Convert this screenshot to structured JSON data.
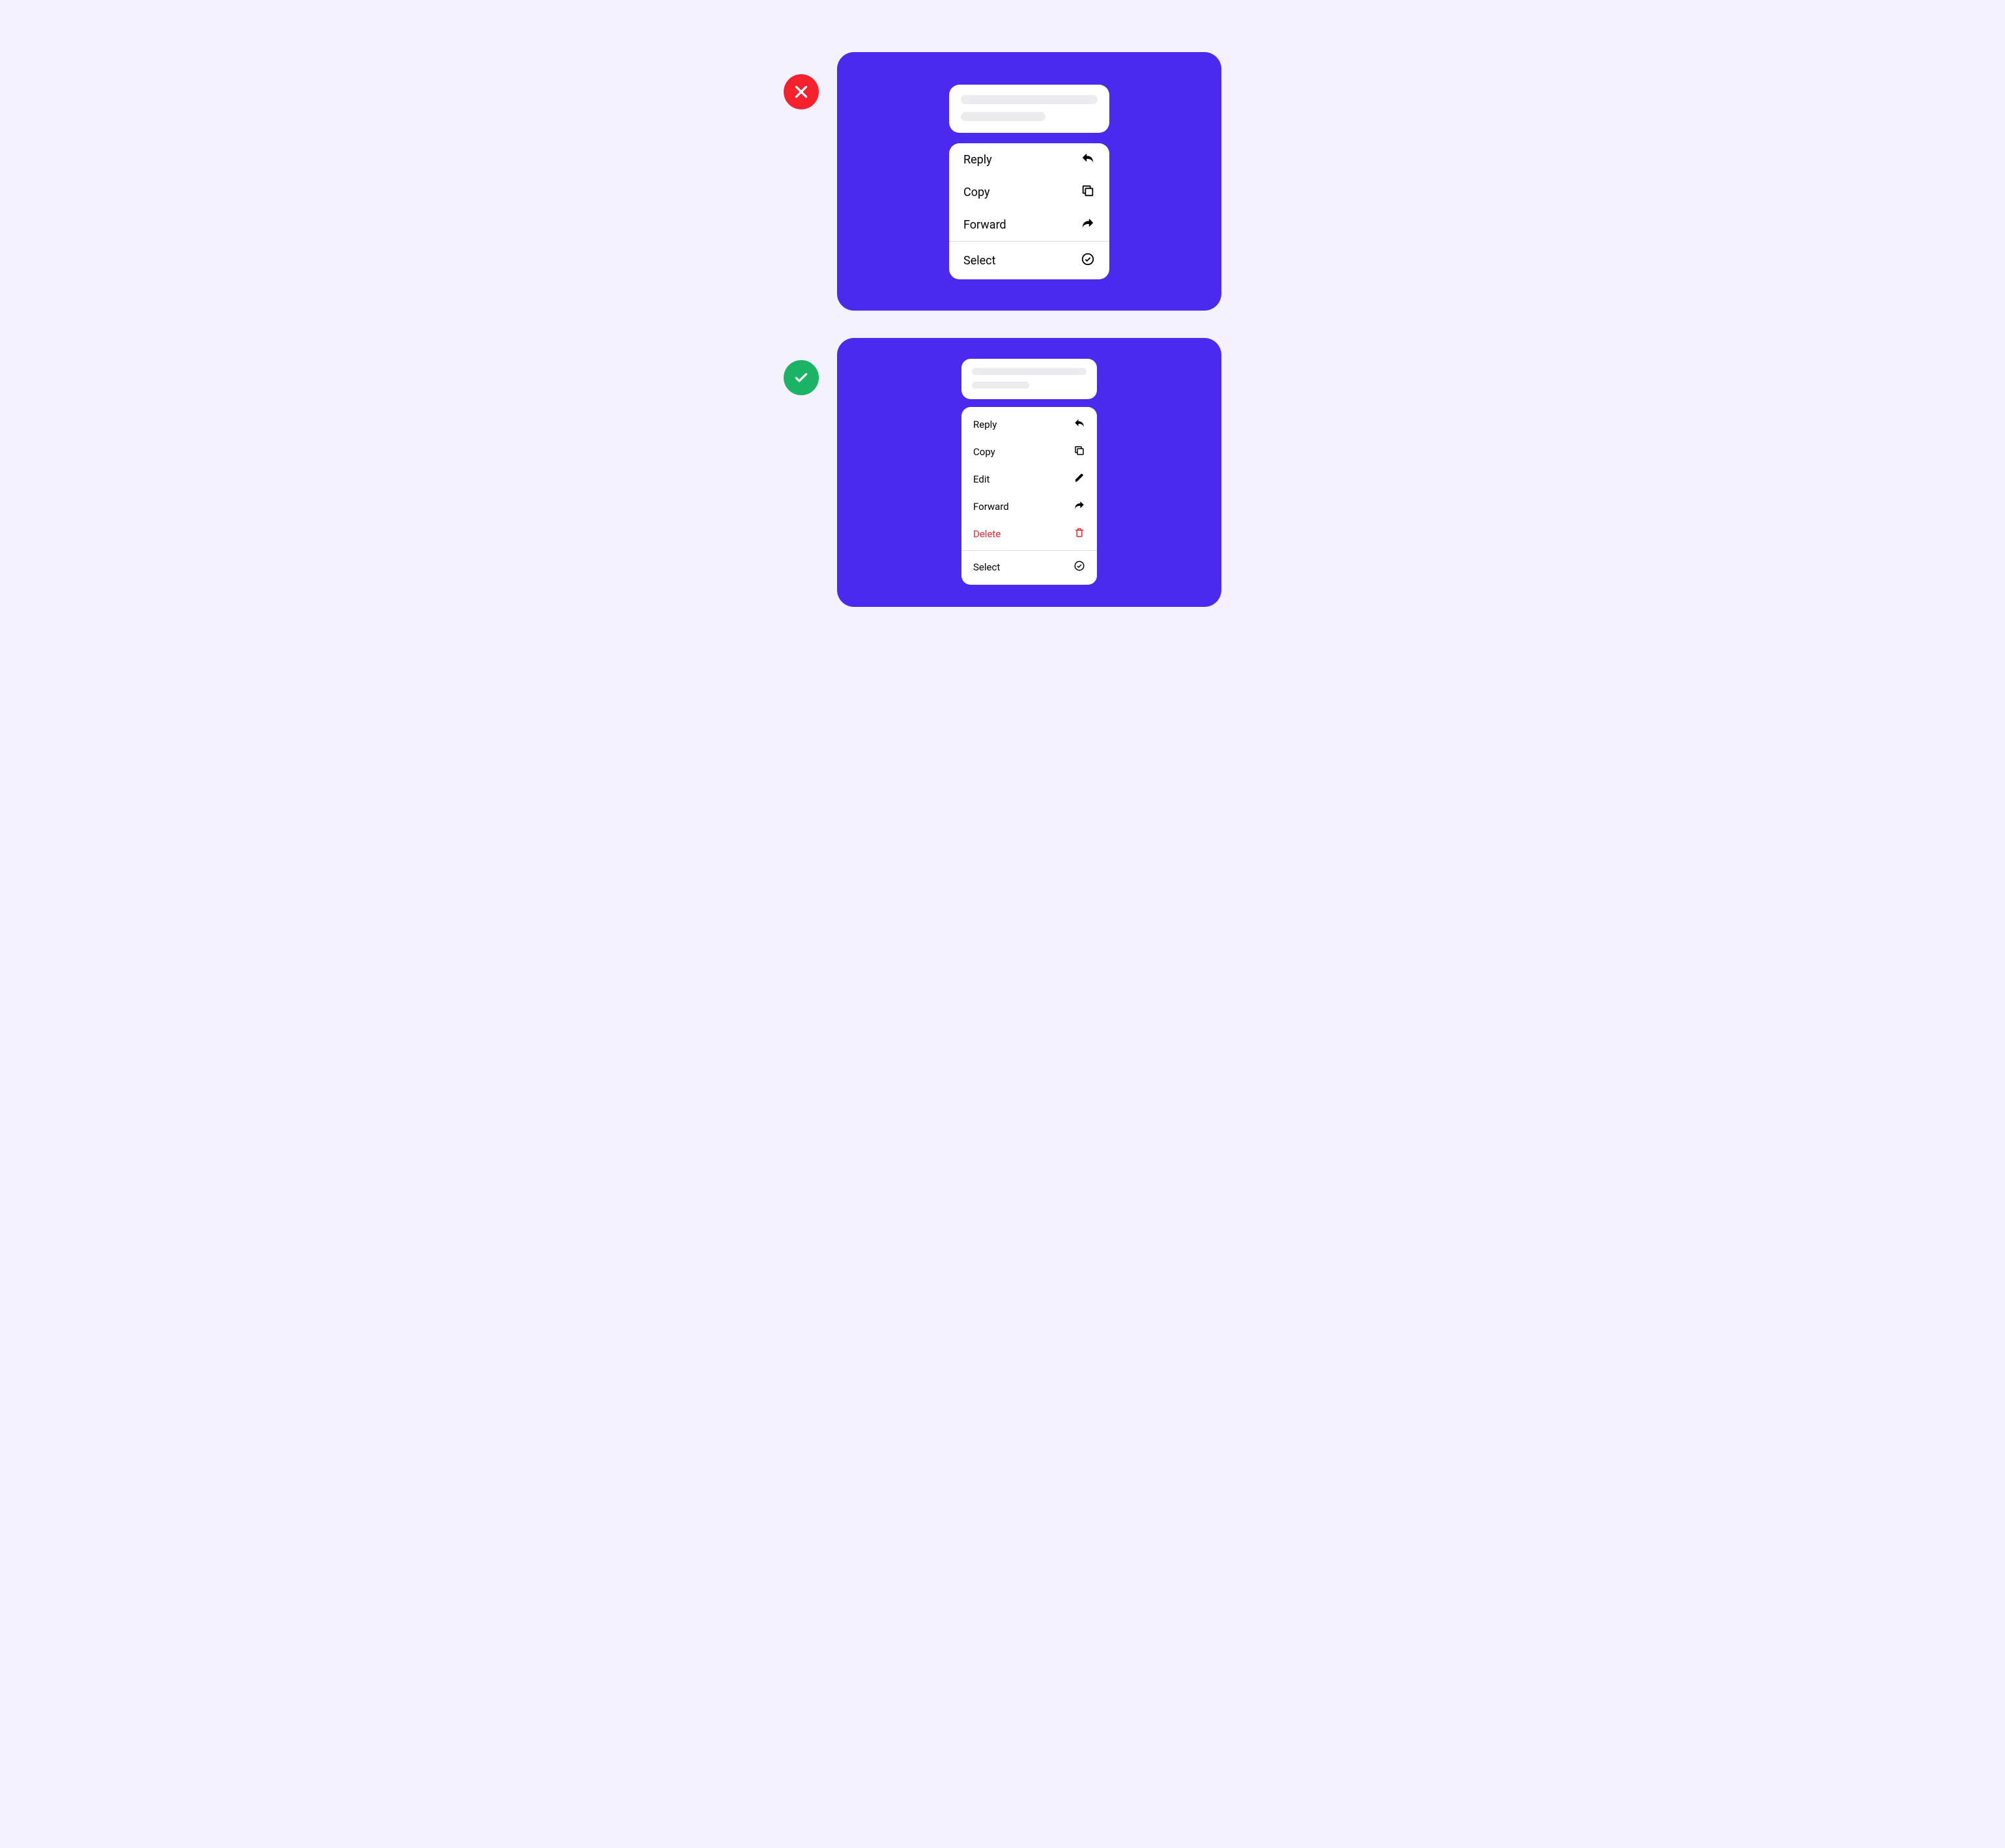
{
  "colors": {
    "page_bg": "#f4f2ff",
    "panel_bg": "#4b2aef",
    "bad_badge": "#f5222d",
    "good_badge": "#1bb465",
    "danger_text": "#f5222d"
  },
  "examples": {
    "dont": {
      "menu_items": [
        {
          "label": "Reply",
          "icon": "reply-icon"
        },
        {
          "label": "Copy",
          "icon": "copy-icon"
        },
        {
          "label": "Forward",
          "icon": "forward-icon"
        }
      ],
      "footer_item": {
        "label": "Select",
        "icon": "check-circle-icon"
      }
    },
    "do": {
      "menu_items": [
        {
          "label": "Reply",
          "icon": "reply-icon"
        },
        {
          "label": "Copy",
          "icon": "copy-icon"
        },
        {
          "label": "Edit",
          "icon": "edit-icon"
        },
        {
          "label": "Forward",
          "icon": "forward-icon"
        },
        {
          "label": "Delete",
          "icon": "trash-icon",
          "danger": true
        }
      ],
      "footer_item": {
        "label": "Select",
        "icon": "check-circle-icon"
      }
    }
  }
}
